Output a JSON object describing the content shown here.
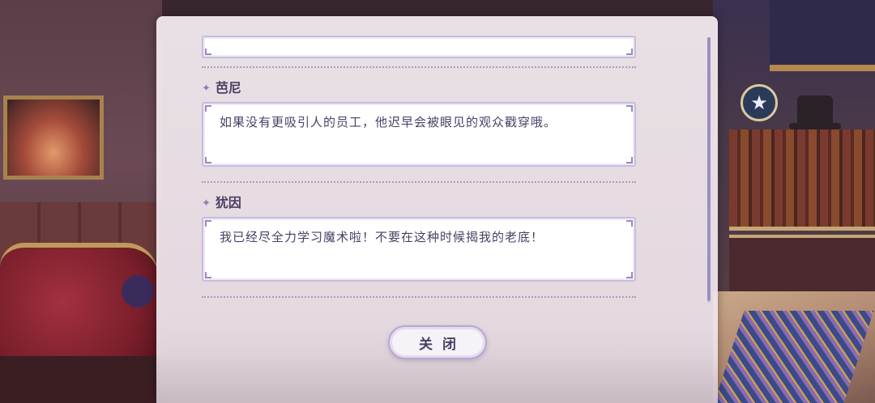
{
  "dialogue_log": {
    "entries": [
      {
        "speaker": "",
        "text": ""
      },
      {
        "speaker": "芭尼",
        "text": "如果没有更吸引人的员工，他迟早会被眼见的观众戳穿哦。"
      },
      {
        "speaker": "犹因",
        "text": "我已经尽全力学习魔术啦！不要在这种时候揭我的老底！"
      }
    ],
    "close_label": "关闭"
  },
  "icons": {
    "speaker_marker": "sparkle-icon",
    "background_badge": "star-icon"
  },
  "colors": {
    "text": "#4a3f63",
    "accent": "#9b8fc0",
    "panel": "#f2eaee"
  }
}
